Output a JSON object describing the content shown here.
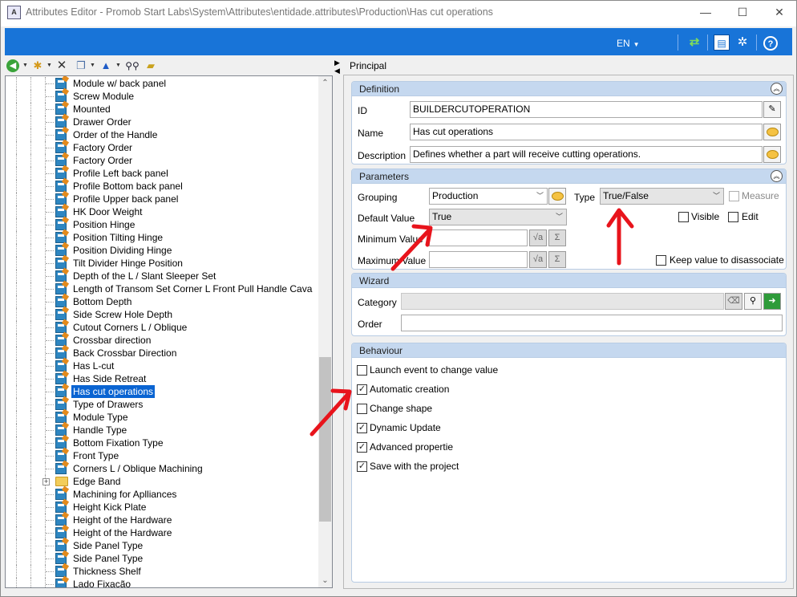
{
  "window": {
    "title": "Attributes Editor - Promob Start Labs\\System\\Attributes\\entidade.attributes\\Production\\Has cut operations",
    "minimize": "—",
    "maximize": "☐",
    "close": "✕"
  },
  "ribbon": {
    "language": "EN",
    "icons": [
      "refresh-icon",
      "layout-icon",
      "settings-icon",
      "help-icon"
    ]
  },
  "toolbar": {
    "icons": [
      "back-icon",
      "new-folder-icon",
      "delete-icon",
      "copy-icon",
      "move-up-icon",
      "find-icon",
      "folder-icon"
    ]
  },
  "tree": {
    "items": [
      {
        "label": "Module w/ back panel",
        "type": "attribute"
      },
      {
        "label": "Screw Module",
        "type": "attribute"
      },
      {
        "label": "Mounted",
        "type": "attribute"
      },
      {
        "label": "Drawer Order",
        "type": "attribute"
      },
      {
        "label": "Order of the Handle",
        "type": "attribute"
      },
      {
        "label": "Factory Order",
        "type": "attribute"
      },
      {
        "label": "Factory Order",
        "type": "attribute"
      },
      {
        "label": "Profile Left back panel",
        "type": "attribute"
      },
      {
        "label": "Profile Bottom back panel",
        "type": "attribute"
      },
      {
        "label": "Profile Upper back panel",
        "type": "attribute"
      },
      {
        "label": "HK Door Weight",
        "type": "attribute"
      },
      {
        "label": "Position Hinge",
        "type": "attribute"
      },
      {
        "label": "Position Tilting Hinge",
        "type": "attribute"
      },
      {
        "label": "Position Dividing Hinge",
        "type": "attribute"
      },
      {
        "label": "Tilt Divider Hinge Position",
        "type": "attribute"
      },
      {
        "label": "Depth of the L / Slant Sleeper Set",
        "type": "attribute"
      },
      {
        "label": "Length of Transom Set Corner L Front Pull Handle Cava",
        "type": "attribute"
      },
      {
        "label": "Bottom Depth",
        "type": "attribute"
      },
      {
        "label": "Side Screw Hole Depth",
        "type": "attribute"
      },
      {
        "label": "Cutout Corners L / Oblique",
        "type": "attribute"
      },
      {
        "label": "Crossbar direction",
        "type": "attribute"
      },
      {
        "label": "Back Crossbar Direction",
        "type": "attribute"
      },
      {
        "label": "Has L-cut",
        "type": "attribute"
      },
      {
        "label": "Has Side Retreat",
        "type": "attribute"
      },
      {
        "label": "Has cut operations",
        "type": "attribute",
        "selected": true
      },
      {
        "label": "Type of Drawers",
        "type": "attribute"
      },
      {
        "label": "Module Type",
        "type": "attribute"
      },
      {
        "label": "Handle Type",
        "type": "attribute"
      },
      {
        "label": "Bottom Fixation Type",
        "type": "attribute"
      },
      {
        "label": "Front Type",
        "type": "attribute"
      },
      {
        "label": "Corners L / Oblique Machining",
        "type": "attribute"
      },
      {
        "label": "Edge Band",
        "type": "folder"
      },
      {
        "label": "Machining for Aplliances",
        "type": "attribute"
      },
      {
        "label": "Height Kick Plate",
        "type": "attribute"
      },
      {
        "label": "Height of the Hardware",
        "type": "attribute"
      },
      {
        "label": "Height of the Hardware",
        "type": "attribute"
      },
      {
        "label": "Side Panel Type",
        "type": "attribute"
      },
      {
        "label": "Side Panel Type",
        "type": "attribute"
      },
      {
        "label": "Thickness Shelf",
        "type": "attribute"
      },
      {
        "label": "Lado Fixação",
        "type": "attribute"
      }
    ]
  },
  "right": {
    "tab_label": "Principal",
    "definition": {
      "header": "Definition",
      "id_label": "ID",
      "id_value": "BUILDERCUTOPERATION",
      "name_label": "Name",
      "name_value": "Has cut operations",
      "description_label": "Description",
      "description_value": "Defines whether a part will receive cutting operations."
    },
    "parameters": {
      "header": "Parameters",
      "grouping_label": "Grouping",
      "grouping_value": "Production",
      "type_label": "Type",
      "type_value": "True/False",
      "measure_label": "Measure",
      "default_label": "Default Value",
      "default_value": "True",
      "visible_label": "Visible",
      "edit_label": "Edit",
      "min_label": "Minimum Value",
      "max_label": "Maximum Value",
      "keep_label": "Keep value to disassociate",
      "formula_glyph": "√a",
      "sum_glyph": "Σ"
    },
    "wizard": {
      "header": "Wizard",
      "category_label": "Category",
      "order_label": "Order"
    },
    "behaviour": {
      "header": "Behaviour",
      "options": [
        {
          "label": "Launch event to change value",
          "checked": false
        },
        {
          "label": "Automatic creation",
          "checked": true
        },
        {
          "label": "Change shape",
          "checked": false
        },
        {
          "label": "Dynamic Update",
          "checked": true
        },
        {
          "label": "Advanced propertie",
          "checked": true
        },
        {
          "label": "Save with the project",
          "checked": true
        }
      ]
    }
  },
  "colors": {
    "ribbon": "#1874d8",
    "selection": "#0a64d2",
    "group_header": "#c5d8ef",
    "annotation_arrow": "#e8141c"
  }
}
